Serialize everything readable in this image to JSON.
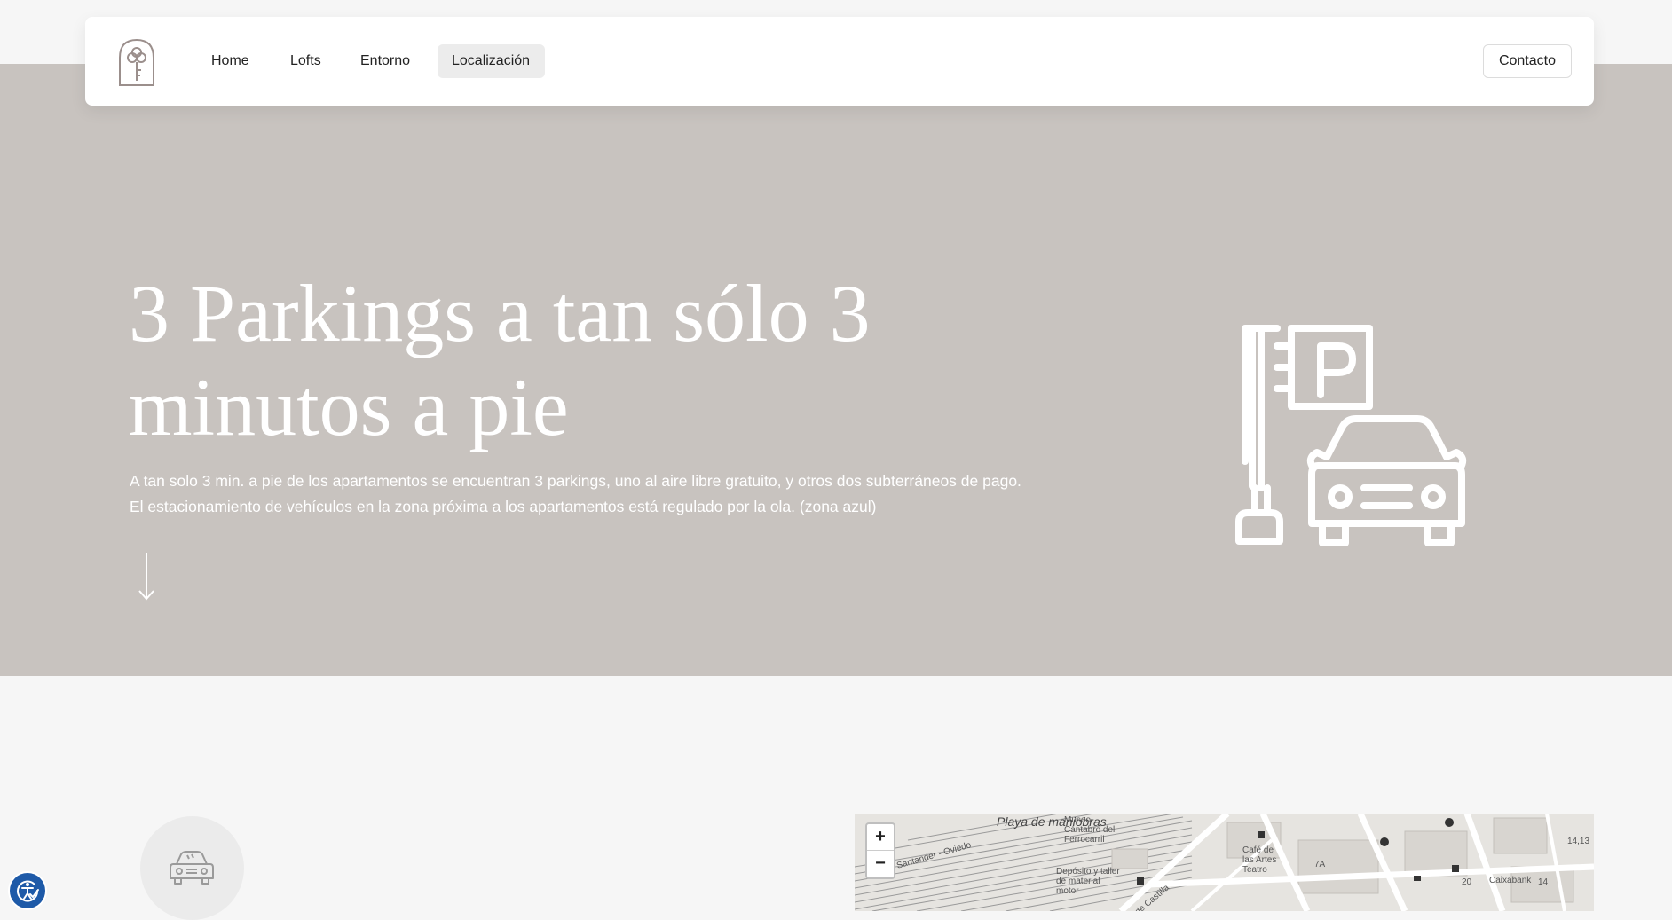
{
  "nav": {
    "items": [
      {
        "label": "Home"
      },
      {
        "label": "Lofts"
      },
      {
        "label": "Entorno"
      },
      {
        "label": "Localización",
        "active": true
      }
    ],
    "contact_label": "Contacto"
  },
  "hero": {
    "title": "3 Parkings a tan sólo 3 minutos a pie",
    "description": "A tan solo 3 min. a pie de los apartamentos se encuentran 3 parkings, uno al aire libre gratuito, y otros dos subterráneos de pago. El estacionamiento de vehículos en la zona próxima a los apartamentos está regulado por la ola. (zona azul)",
    "icon": "parking-sign-car-icon",
    "arrow_icon": "arrow-down-icon"
  },
  "feature": {
    "icon": "car-icon"
  },
  "map": {
    "zoom_in": "+",
    "zoom_out": "−",
    "labels": {
      "playa": "Playa de maniobras",
      "museo": "Museo Cántabro del Ferrocarril",
      "deposito": "Depósito y taller de material motor",
      "santander": "Santander - Oviedo",
      "castilla": "de Castilla",
      "cafe": "Café de las Artes Teatro",
      "caixabank": "Caixabank",
      "n7a": "7A",
      "n14": "14",
      "n20": "20",
      "n1413": "14,13"
    }
  },
  "colors": {
    "hero_bg": "#c8c3bf",
    "page_bg": "#f6f6f6",
    "accessibility": "#1e5aa8"
  },
  "accessibility": {
    "icon": "accessibility-icon"
  }
}
